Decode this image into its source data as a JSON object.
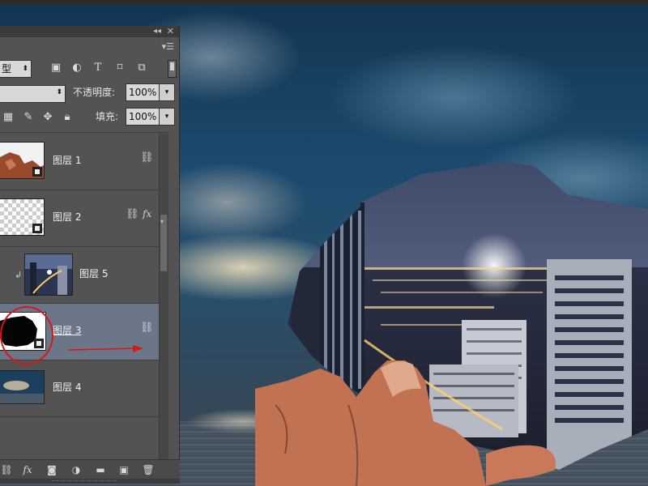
{
  "layers_panel": {
    "filter_kind_value": "型",
    "opacity_label": "不透明度:",
    "opacity_value": "100%",
    "fill_label": "填充:",
    "fill_value": "100%",
    "layers": [
      {
        "name": "图层 1",
        "has_link": true,
        "has_fx": false,
        "clipped": false,
        "selected": false,
        "thumb": "hand-photo"
      },
      {
        "name": "图层 2",
        "has_link": true,
        "has_fx": true,
        "clipped": false,
        "selected": false,
        "thumb": "transparent"
      },
      {
        "name": "图层 5",
        "has_link": false,
        "has_fx": false,
        "clipped": true,
        "selected": false,
        "thumb": "city-night"
      },
      {
        "name": "图层 3",
        "has_link": true,
        "has_fx": false,
        "clipped": false,
        "selected": true,
        "thumb": "black-mask"
      },
      {
        "name": "图层 4",
        "has_link": false,
        "has_fx": false,
        "clipped": false,
        "selected": false,
        "thumb": "sky-sea"
      }
    ],
    "fx_label": "fx"
  },
  "colors": {
    "panel_bg": "#535353",
    "selected_row": "#6c7689",
    "annotation_red": "#d8171a"
  },
  "icons": [
    "double-chevron-icon",
    "close-icon",
    "panel-menu-icon",
    "image-filter-icon",
    "adjustment-filter-icon",
    "type-filter-icon",
    "shape-filter-icon",
    "smart-object-filter-icon",
    "lock-pixels-icon",
    "lock-paint-icon",
    "lock-position-icon",
    "lock-all-icon",
    "link-icon",
    "fx-icon",
    "clip-arrow-icon",
    "new-group-icon",
    "add-mask-icon",
    "adjustment-layer-icon",
    "folder-icon",
    "new-layer-icon",
    "trash-icon"
  ]
}
